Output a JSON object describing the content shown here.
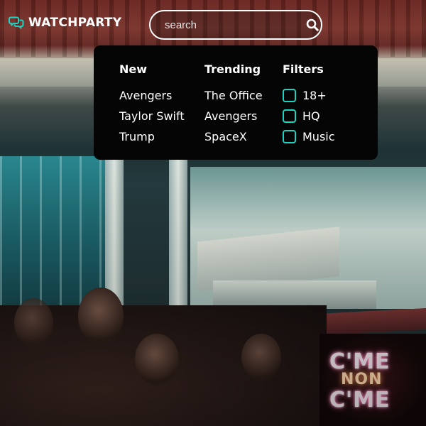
{
  "brand": {
    "name": "WATCHPARTY",
    "icon": "chat-bubbles-icon",
    "accent_color": "#1ed3c2"
  },
  "search": {
    "placeholder": "search",
    "value": "",
    "icon": "search-icon"
  },
  "dropdown": {
    "new": {
      "heading": "New",
      "items": [
        "Avengers",
        "Taylor Swift",
        "Trump"
      ]
    },
    "trending": {
      "heading": "Trending",
      "items": [
        "The Office",
        "Avengers",
        "SpaceX"
      ]
    },
    "filters": {
      "heading": "Filters",
      "items": [
        {
          "label": "18+",
          "checked": false
        },
        {
          "label": "HQ",
          "checked": false
        },
        {
          "label": "Music",
          "checked": false
        }
      ]
    }
  }
}
